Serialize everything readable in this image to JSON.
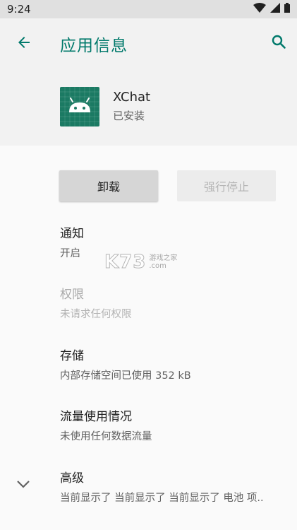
{
  "status_bar": {
    "time": "9:24",
    "icons": [
      "wifi-icon",
      "signal-icon",
      "battery-icon"
    ]
  },
  "app_bar": {
    "title": "应用信息",
    "back_icon": "arrow-back-icon",
    "search_icon": "search-icon",
    "accent_color": "#00796b"
  },
  "app": {
    "name": "XChat",
    "status": "已安装",
    "icon": "android-robot-icon",
    "icon_color": "#1b7a63"
  },
  "buttons": {
    "uninstall": "卸载",
    "force_stop": "强行停止"
  },
  "items": [
    {
      "title": "通知",
      "subtitle": "开启",
      "enabled": true
    },
    {
      "title": "权限",
      "subtitle": "未请求任何权限",
      "enabled": false
    },
    {
      "title": "存储",
      "subtitle": "内部存储空间已使用 352 kB",
      "enabled": true
    },
    {
      "title": "流量使用情况",
      "subtitle": "未使用任何数据流量",
      "enabled": true
    },
    {
      "title": "高级",
      "subtitle": "当前显示了 当前显示了 当前显示了 电池 项..",
      "enabled": true
    }
  ],
  "watermark": {
    "logo": "K73",
    "line1": "游戏之家",
    "line2": ".com"
  }
}
